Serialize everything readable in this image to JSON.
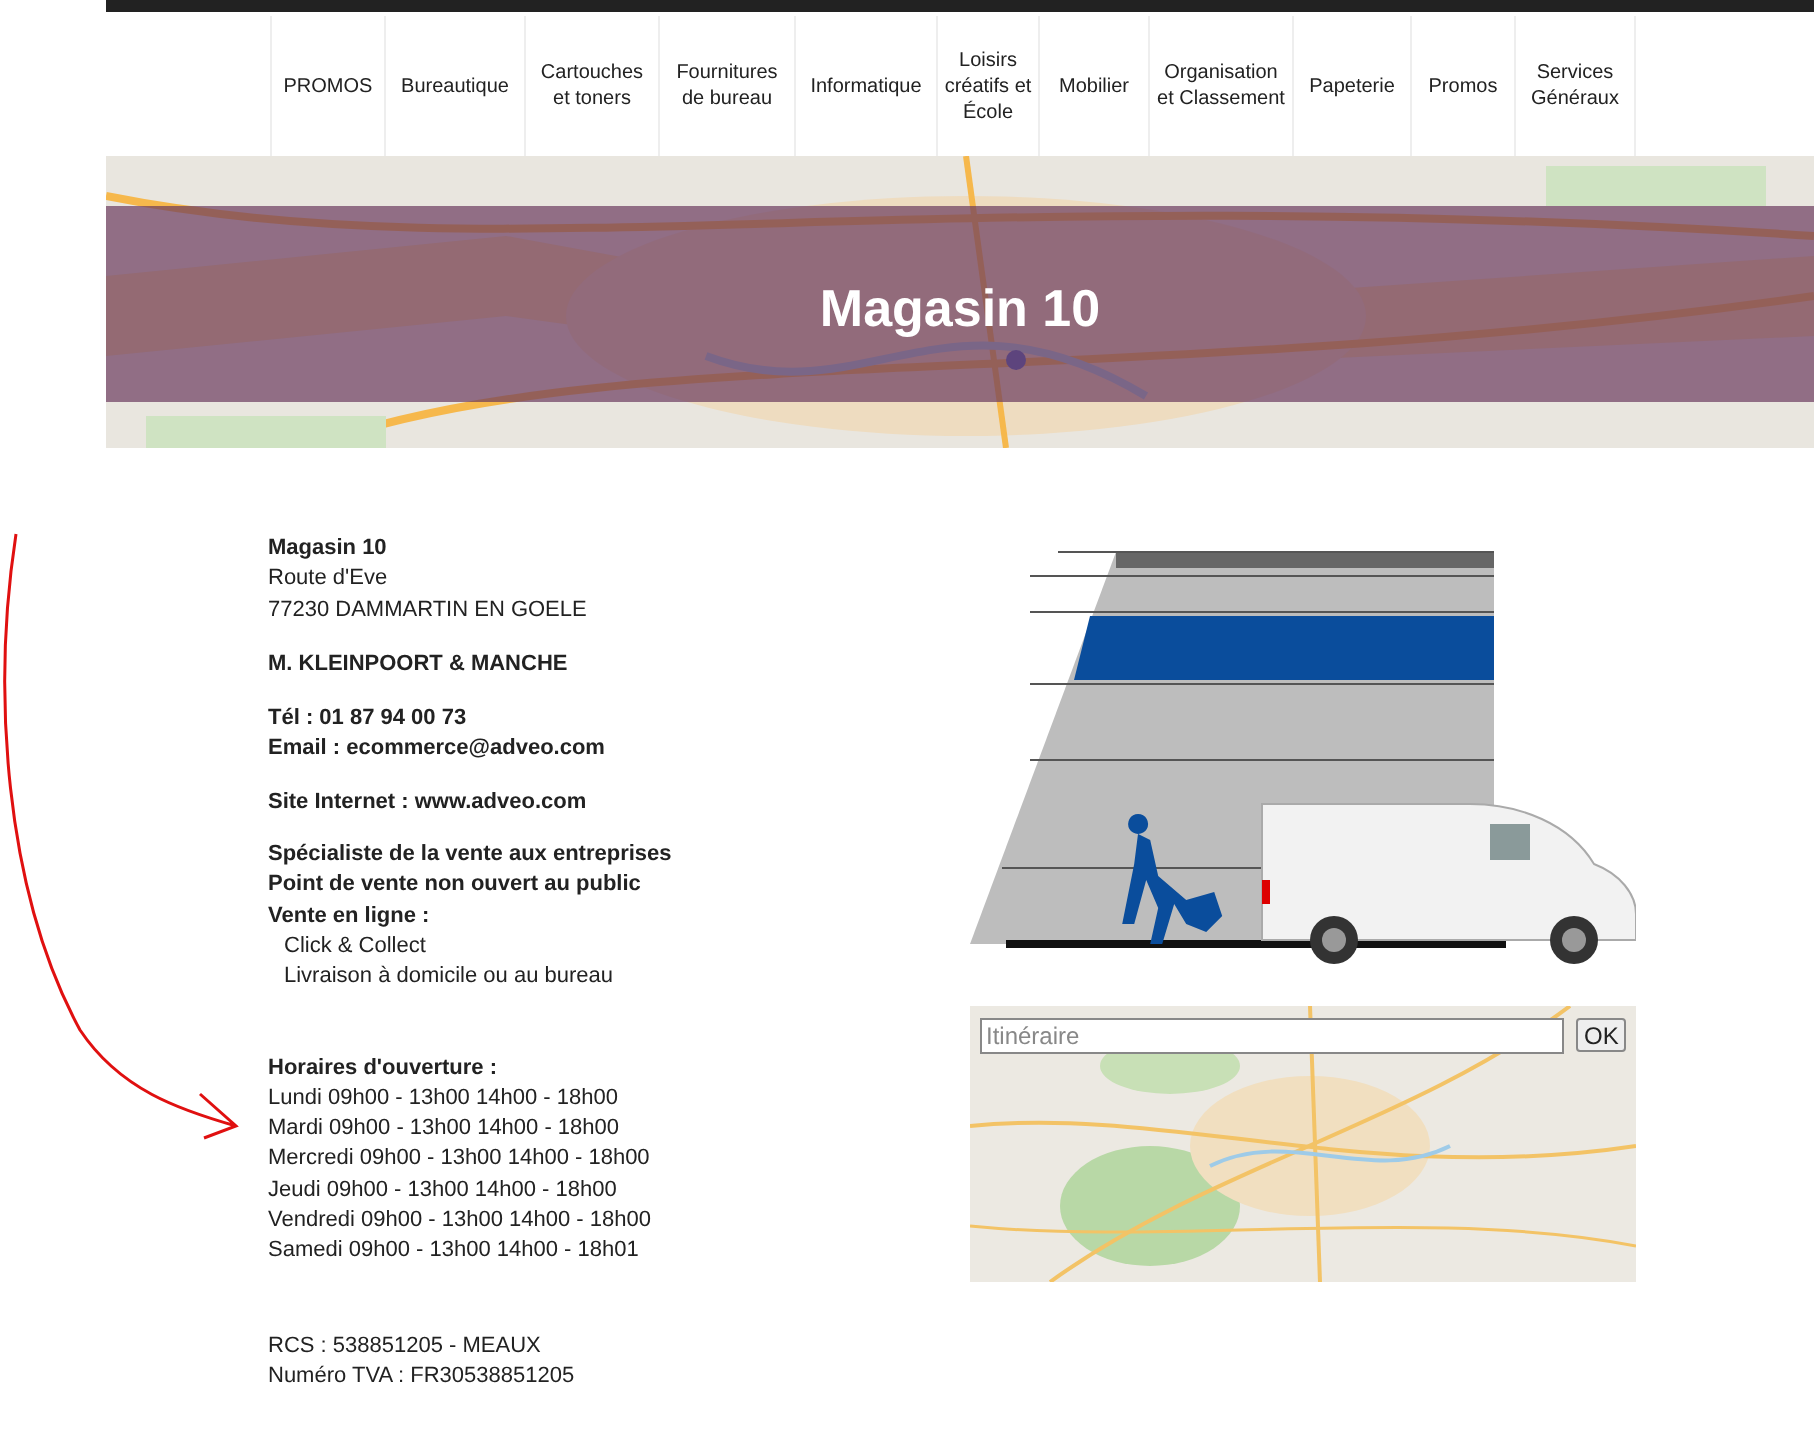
{
  "nav": {
    "items": [
      "PROMOS",
      "Bureautique",
      "Cartouches et toners",
      "Fournitures de bureau",
      "Informatique",
      "Loisirs créatifs et École",
      "Mobilier",
      "Organisation et Classement",
      "Papeterie",
      "Promos",
      "Services Généraux"
    ]
  },
  "banner": {
    "title": "Magasin 10"
  },
  "info": {
    "blocks": [
      {
        "lines": [
          {
            "text": "Magasin 10",
            "kind": "bold"
          },
          {
            "text": "Route d'Eve",
            "kind": "plain"
          },
          {
            "text": "77230 DAMMARTIN EN GOELE",
            "kind": "plain"
          }
        ]
      },
      {
        "lines": [
          {
            "text": "M. KLEINPOORT & MANCHE",
            "kind": "bold"
          }
        ]
      },
      {
        "lines": [
          {
            "text": "Tél : 01 87 94 00 73",
            "kind": "bold"
          },
          {
            "text": "Email : ecommerce@adveo.com",
            "kind": "bold"
          }
        ]
      },
      {
        "lines": [
          {
            "text": "Site Internet : www.adveo.com",
            "kind": "bold"
          }
        ]
      },
      {
        "lines": [
          {
            "text": "Spécialiste de la vente aux entreprises",
            "kind": "bold"
          },
          {
            "text": "Point de vente non ouvert au public",
            "kind": "bold"
          },
          {
            "text": "Vente en ligne :",
            "kind": "bold"
          },
          {
            "text": "Click & Collect",
            "kind": "indent"
          },
          {
            "text": "Livraison à domicile ou au bureau",
            "kind": "indent"
          }
        ]
      },
      {
        "lines": [
          {
            "text": "Horaires d'ouverture :",
            "kind": "bold"
          },
          {
            "text": "Lundi 09h00 - 13h00 14h00 - 18h00",
            "kind": "plain"
          },
          {
            "text": "Mardi 09h00 - 13h00 14h00 - 18h00",
            "kind": "plain"
          },
          {
            "text": "Mercredi 09h00 - 13h00 14h00 - 18h00",
            "kind": "plain"
          },
          {
            "text": "Jeudi 09h00 - 13h00 14h00 - 18h00",
            "kind": "plain"
          },
          {
            "text": "Vendredi 09h00 - 13h00 14h00 - 18h00",
            "kind": "plain"
          },
          {
            "text": "Samedi 09h00 - 13h00 14h00 - 18h01",
            "kind": "plain"
          }
        ]
      },
      {
        "lines": [
          {
            "text": "RCS : 538851205 - MEAUX",
            "kind": "plain"
          },
          {
            "text": "Numéro TVA : FR30538851205",
            "kind": "plain"
          }
        ]
      }
    ]
  },
  "route": {
    "placeholder": "Itinéraire",
    "button": "OK"
  }
}
